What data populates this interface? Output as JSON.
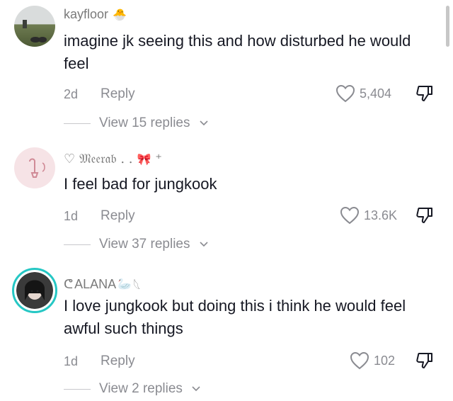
{
  "comments": [
    {
      "username": "kayfloor",
      "username_emoji": "🐣",
      "text": "imagine jk seeing this and how disturbed he would feel",
      "time": "2d",
      "reply": "Reply",
      "likes": "5,404",
      "view_replies": "View 15 replies"
    },
    {
      "username": "𝔐𝔢𝔢𝔯𝔞𝔟 . .",
      "username_prefix": "♡",
      "username_suffix": "⁺",
      "text": "I feel bad for jungkook",
      "time": "1d",
      "reply": "Reply",
      "likes": "13.6K",
      "view_replies": "View 37 replies"
    },
    {
      "username": "ALANA",
      "username_prefix": "ᕦ",
      "username_suffix": "𓆩",
      "text": "I love jungkook but doing this i think he would feel awful such things",
      "time": "1d",
      "reply": "Reply",
      "likes": "102",
      "view_replies": "View 2 replies"
    }
  ],
  "colors": {
    "text": "#161823",
    "muted": "#8a8b91",
    "ring": "#25c7c4"
  },
  "icons": {
    "like": "heart-outline-icon",
    "dislike": "thumbs-down-outline-icon",
    "expand": "chevron-down-icon"
  }
}
